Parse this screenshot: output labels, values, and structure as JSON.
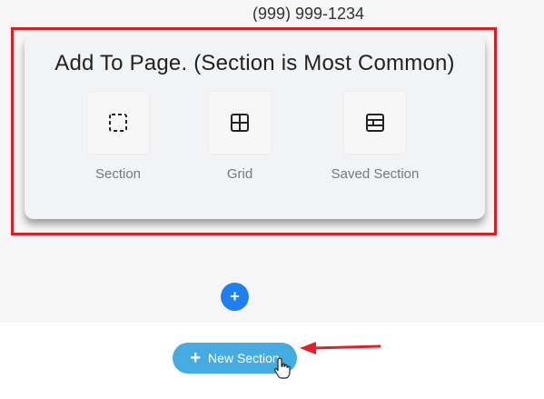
{
  "background_text": {
    "phone": "(999) 999-1234"
  },
  "panel": {
    "title": "Add To Page. (Section is Most Common)",
    "options": [
      {
        "label": "Section",
        "icon": "dashed-square-icon"
      },
      {
        "label": "Grid",
        "icon": "grid-icon"
      },
      {
        "label": "Saved Section",
        "icon": "saved-section-icon"
      }
    ]
  },
  "add_button": {
    "symbol": "+",
    "color": "#1d7ff2"
  },
  "new_section_button": {
    "symbol": "+",
    "label": "New Section",
    "color": "#45ace3"
  },
  "annotations": {
    "highlight_color": "#d9202a",
    "arrow_color": "#e3202a"
  }
}
